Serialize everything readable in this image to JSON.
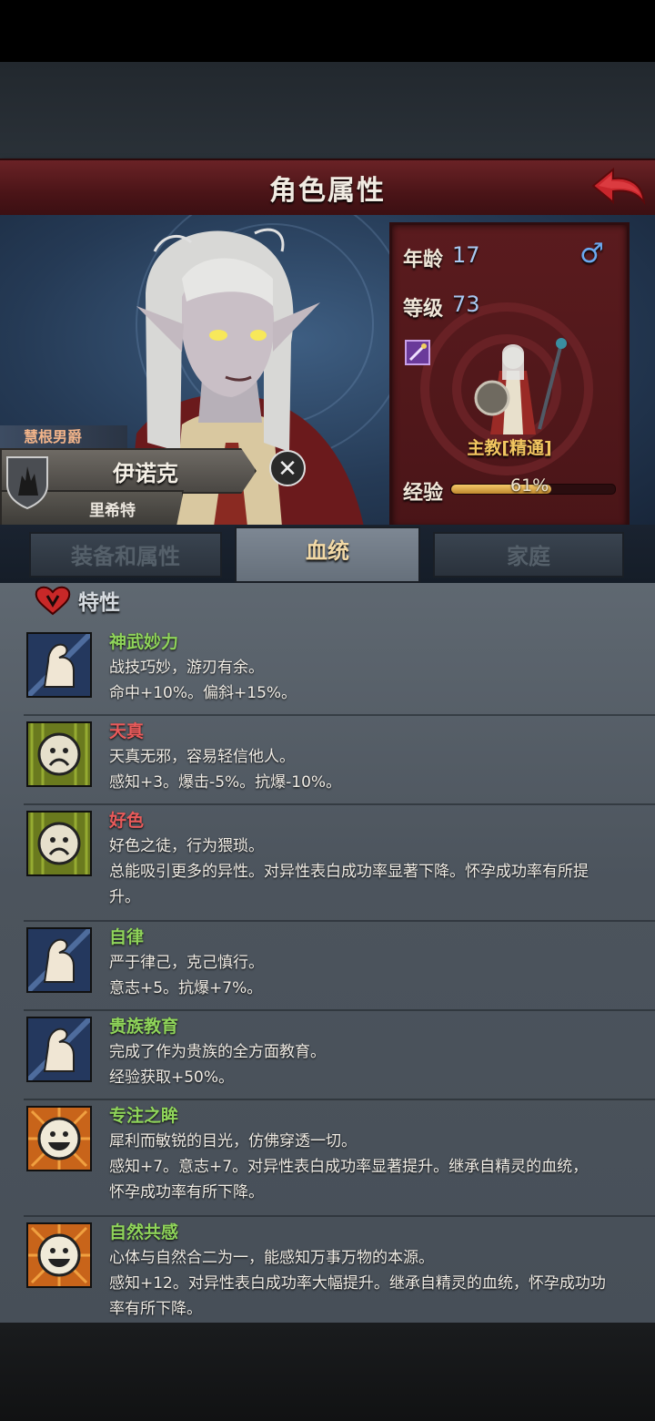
{
  "header": {
    "title": "角色属性"
  },
  "character": {
    "title_tag": "慧根男爵",
    "name": "伊诺克",
    "house": "里希特",
    "age_label": "年龄",
    "age": "17",
    "gender_symbol": "♂",
    "level_label": "等级",
    "level": "73",
    "class_name": "主教[精通]",
    "exp_label": "经验",
    "exp_text": "61%",
    "exp_progress": 0.61
  },
  "tabs": [
    {
      "label": "装备和属性",
      "active": false
    },
    {
      "label": "血统",
      "active": true
    },
    {
      "label": "家庭",
      "active": false
    }
  ],
  "section": {
    "title": "特性"
  },
  "traits": [
    {
      "icon": "muscle-arm-icon",
      "name": "神武妙力",
      "name_color": "green",
      "lines": [
        "战技巧妙，游刃有余。",
        "命中+10%。偏斜+15%。"
      ]
    },
    {
      "icon": "sad-face-icon",
      "name": "天真",
      "name_color": "red",
      "lines": [
        "天真无邪，容易轻信他人。",
        "感知+3。爆击-5%。抗爆-10%。"
      ]
    },
    {
      "icon": "sad-face-icon",
      "name": "好色",
      "name_color": "red",
      "lines": [
        "好色之徒，行为猥琐。",
        "总能吸引更多的异性。对异性表白成功率显著下降。怀孕成功率有所提",
        "升。"
      ]
    },
    {
      "icon": "muscle-arm-icon",
      "name": "自律",
      "name_color": "green",
      "lines": [
        "严于律己，克己慎行。",
        "意志+5。抗爆+7%。"
      ]
    },
    {
      "icon": "muscle-arm-icon",
      "name": "贵族教育",
      "name_color": "green",
      "lines": [
        "完成了作为贵族的全方面教育。",
        "经验获取+50%。"
      ]
    },
    {
      "icon": "happy-face-icon",
      "name": "专注之眸",
      "name_color": "green",
      "lines": [
        "犀利而敏锐的目光，仿佛穿透一切。",
        "感知+7。意志+7。对异性表白成功率显著提升。继承自精灵的血统，",
        "怀孕成功率有所下降。"
      ]
    },
    {
      "icon": "happy-face-icon",
      "name": "自然共感",
      "name_color": "green",
      "lines": [
        "心体与自然合二为一，能感知万事万物的本源。",
        "感知+12。对异性表白成功率大幅提升。继承自精灵的血统，怀孕成功功",
        "率有所下降。"
      ]
    }
  ]
}
